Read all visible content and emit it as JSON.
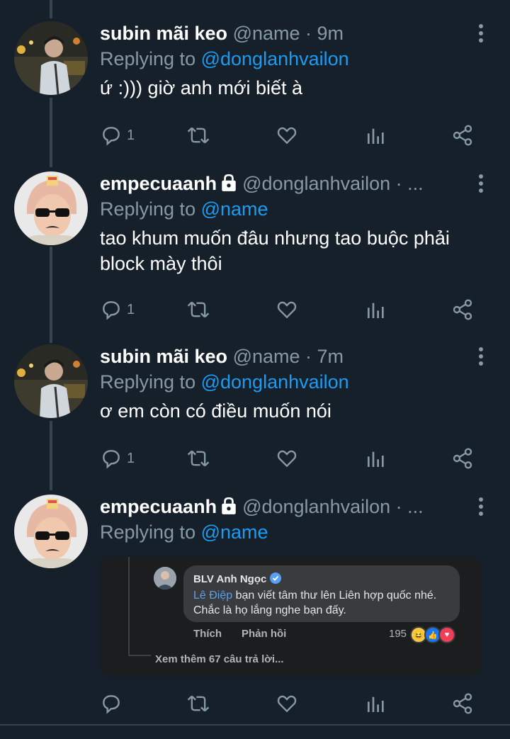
{
  "tweets": [
    {
      "username": "subin mãi keo",
      "handle": "@name · 9m",
      "replying_prefix": "Replying to ",
      "replying_to": "@donglanhvailon",
      "text": "ứ :))) giờ anh mới biết à",
      "reply_count": "1",
      "avatar": "avatar-boy-night",
      "locked": false
    },
    {
      "username": "empecuaanh",
      "handle": "@donglanhvailon · ...",
      "replying_prefix": "Replying to ",
      "replying_to": "@name",
      "text": "tao khum muốn đâu nhưng tao buộc phải block mày thôi",
      "reply_count": "1",
      "avatar": "avatar-sunglasses",
      "locked": true
    },
    {
      "username": "subin mãi keo",
      "handle": "@name · 7m",
      "replying_prefix": "Replying to ",
      "replying_to": "@donglanhvailon",
      "text": "ơ em còn có điều muốn nói",
      "reply_count": "1",
      "avatar": "avatar-boy-night",
      "locked": false
    },
    {
      "username": "empecuaanh",
      "handle": "@donglanhvailon · ...",
      "replying_prefix": "Replying to ",
      "replying_to": "@name",
      "text": "",
      "reply_count": "",
      "avatar": "avatar-sunglasses",
      "locked": true
    }
  ],
  "embed": {
    "commenter": "BLV Anh Ngọc",
    "tag": "Lê Điệp",
    "comment": " bạn viết tâm thư lên Liên hợp quốc nhé. Chắc là họ lắng nghe bạn đấy.",
    "like_label": "Thích",
    "reply_label": "Phản hồi",
    "reaction_count": "195",
    "more_replies": "Xem thêm 67 câu trả lời..."
  },
  "icons": [
    "reply-icon",
    "retweet-icon",
    "like-icon",
    "analytics-icon",
    "share-icon",
    "more-icon",
    "lock-icon",
    "verified-icon"
  ],
  "colors": {
    "background": "#15202b",
    "muted": "#8899a6",
    "accent": "#1d9bf0",
    "divider": "#38444d"
  }
}
